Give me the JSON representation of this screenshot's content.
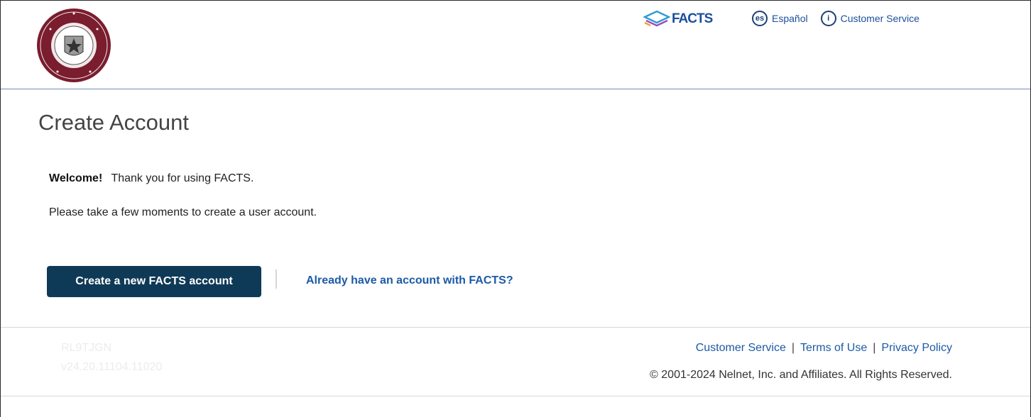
{
  "header": {
    "facts_logo_text": "FACTS",
    "lang_icon_text": "es",
    "lang_label": "Español",
    "info_icon_text": "i",
    "customer_service_label": "Customer Service"
  },
  "main": {
    "title": "Create Account",
    "welcome_bold": "Welcome!",
    "welcome_text": "Thank you for using FACTS.",
    "subtitle": "Please take a few moments to create a user account.",
    "create_button_label": "Create a new FACTS account",
    "already_have_label": "Already have an account with FACTS?"
  },
  "footer": {
    "code": "RL9TJGN",
    "version": "v24.20.11104.11020",
    "links": [
      "Customer Service",
      "Terms of Use",
      "Privacy Policy"
    ],
    "separator": "|",
    "copyright": "© 2001-2024 Nelnet, Inc. and Affiliates. All Rights Reserved."
  },
  "colors": {
    "button_bg": "#0f3a57",
    "link": "#1c5aa6",
    "facts_brand": "#1c4f9c"
  }
}
